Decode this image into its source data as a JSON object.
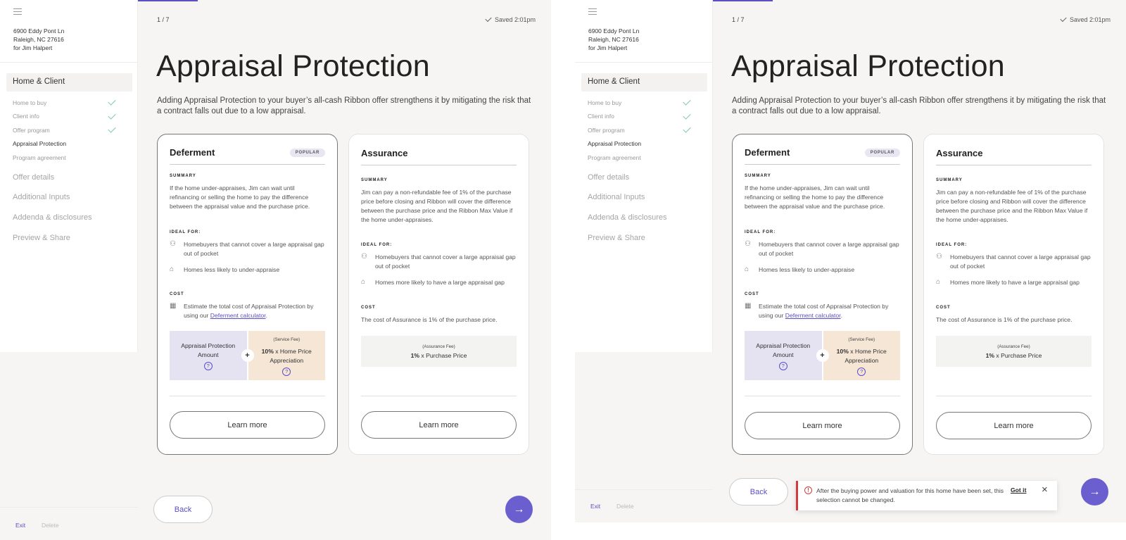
{
  "panels": [
    {
      "address": [
        "6900 Eddy Pont Ln",
        "Raleigh, NC 27616",
        "for Jim Halpert"
      ],
      "active_section": "Home & Client",
      "substeps": [
        {
          "label": "Home to buy",
          "done": true
        },
        {
          "label": "Client info",
          "done": true
        },
        {
          "label": "Offer program",
          "done": true
        },
        {
          "label": "Appraisal Protection",
          "done": false
        },
        {
          "label": "Program agreement",
          "done": false
        }
      ],
      "sections": [
        "Offer details",
        "Additional Inputs",
        "Addenda & disclosures",
        "Preview & Share"
      ],
      "footer": {
        "exit": "Exit",
        "delete": "Delete"
      },
      "step": "1 / 7",
      "progress_fraction": 0.14,
      "saved": "Saved 2:01pm",
      "title": "Appraisal Protection",
      "intro": "Adding Appraisal Protection to your buyer’s all-cash Ribbon offer strengthens it by mitigating the risk that a contract falls out due to a low appraisal.",
      "deferment": {
        "title": "Deferment",
        "badge": "POPULAR",
        "summary_label": "SUMMARY",
        "summary": "If the home under-appraises, Jim can wait until refinancing or selling the home to pay the difference between the appraisal value and the purchase price.",
        "ideal_label": "IDEAL FOR:",
        "ideal": [
          "Homebuyers that cannot cover a large appraisal gap out of pocket",
          "Homes less likely to under-appraise"
        ],
        "cost_label": "COST",
        "cost_text": "Estimate the total cost of Appraisal Protection by using our ",
        "cost_link": "Deferment calculator",
        "cost_end": ".",
        "formula_left": "Appraisal Protection Amount",
        "formula_right_small": "(Service Fee)",
        "formula_right_pct": "10%",
        "formula_right_text": " x Home Price Appreciation",
        "help": "?",
        "plus": "+",
        "learn_more": "Learn more"
      },
      "assurance": {
        "title": "Assurance",
        "summary_label": "SUMMARY",
        "summary": "Jim can pay a non-refundable fee of 1% of the purchase price before closing and Ribbon will cover the difference between the purchase price and the Ribbon Max Value if the home under-appraises.",
        "ideal_label": "IDEAL FOR:",
        "ideal": [
          "Homebuyers that cannot cover a large appraisal gap out of pocket",
          "Homes more likely to have a large appraisal gap"
        ],
        "cost_label": "COST",
        "cost_text": "The cost of Assurance is 1% of the purchase price.",
        "fee_small": "(Assurance Fee)",
        "fee_pct": "1%",
        "fee_text": " x Purchase Price",
        "learn_more": "Learn more"
      },
      "back": "Back"
    }
  ],
  "toast": {
    "message": "After the buying power and valuation for this home have been set, this selection cannot be changed.",
    "action": "Got it",
    "close_icon": "×",
    "warn_icon": "!"
  },
  "icons": {
    "person": "⚇",
    "home": "⌂",
    "calc": "▦",
    "arrow": "→"
  },
  "colors": {
    "accent": "#5b4fc4",
    "error": "#d33a3a",
    "check": "#7cc7a7"
  }
}
